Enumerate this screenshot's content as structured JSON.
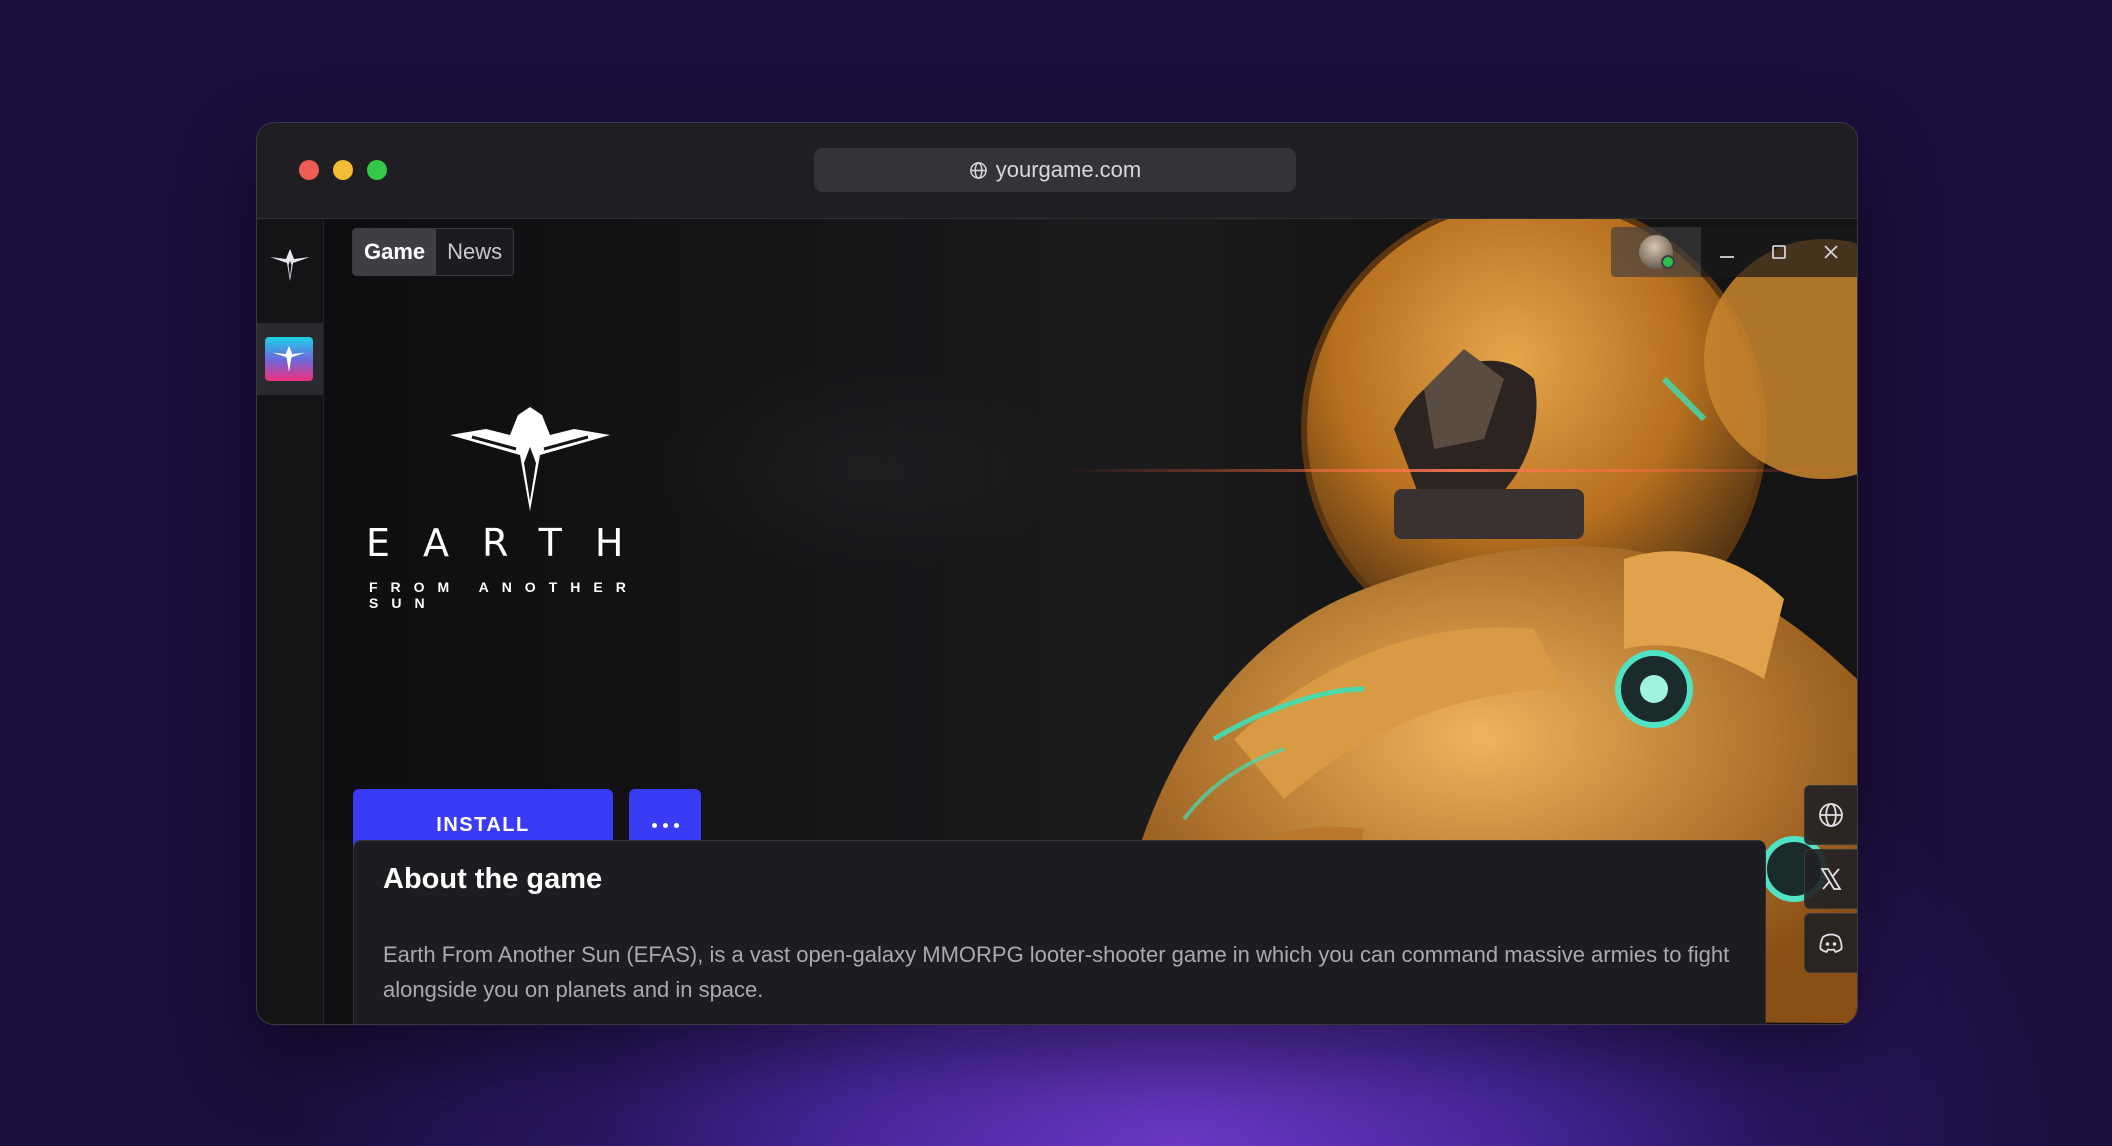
{
  "browser": {
    "url": "yourgame.com",
    "traffic_lights": [
      "#ef5b55",
      "#f2bd32",
      "#34c848"
    ]
  },
  "sidebar": {
    "items": [
      {
        "name": "launcher-logo",
        "icon": "wing-logo-icon"
      },
      {
        "name": "game-efas",
        "icon": "efas-thumbnail",
        "selected": true
      }
    ]
  },
  "tabs": [
    {
      "label": "Game",
      "active": true
    },
    {
      "label": "News",
      "active": false
    }
  ],
  "game": {
    "title": "EARTH",
    "subtitle": "FROM ANOTHER SUN"
  },
  "actions": {
    "install_label": "INSTALL",
    "more_icon": "ellipsis-icon"
  },
  "window_controls": [
    "minimize-icon",
    "maximize-icon",
    "close-icon"
  ],
  "social_links": [
    "globe-icon",
    "x-icon",
    "discord-icon"
  ],
  "about": {
    "heading": "About the game",
    "body": "Earth From Another Sun (EFAS), is a vast open-galaxy MMORPG looter-shooter game in which you can command massive armies to fight alongside you on planets and in space."
  },
  "colors": {
    "accent": "#3a3cf5",
    "background_top": "#1b0f3d",
    "background_glow": "#6a38c4",
    "online_status": "#27c34b"
  }
}
